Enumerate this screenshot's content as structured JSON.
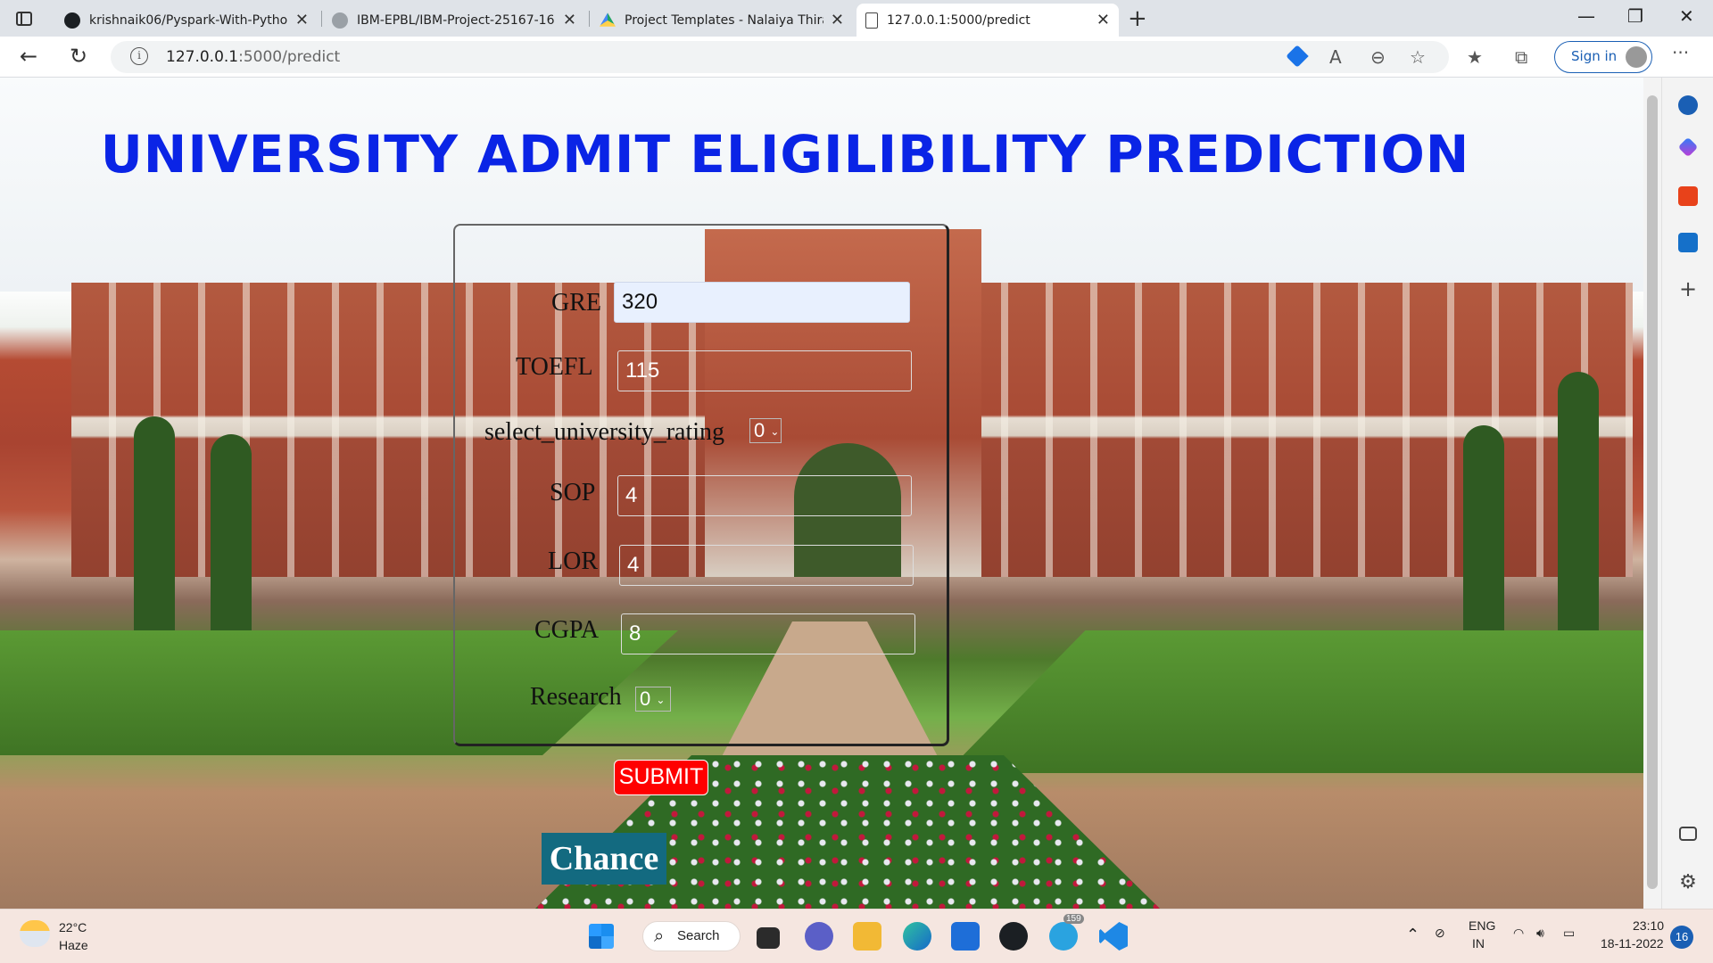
{
  "browser": {
    "tabs": [
      {
        "title": "krishnaik06/Pyspark-With-Pytho",
        "icon": "github-icon"
      },
      {
        "title": "IBM-EPBL/IBM-Project-25167-16",
        "icon": "github-icon"
      },
      {
        "title": "Project Templates - Nalaiya Thira",
        "icon": "google-drive-icon"
      },
      {
        "title": "127.0.0.1:5000/predict",
        "icon": "document-icon"
      }
    ],
    "url_host": "127.0.0.1",
    "url_path": ":5000/predict",
    "signin_label": "Sign in"
  },
  "page": {
    "title": "UNIVERSITY ADMIT ELIGILIBILITY PREDICTION",
    "form": {
      "gre_label": "GRE",
      "gre_value": "320",
      "toefl_label": "TOEFL",
      "toefl_value": "115",
      "rating_label": "select_university_rating",
      "rating_value": "0",
      "sop_label": "SOP",
      "sop_value": "4",
      "lor_label": "LOR",
      "lor_value": "4",
      "cgpa_label": "CGPA",
      "cgpa_value": "8",
      "research_label": "Research",
      "research_value": "0"
    },
    "submit_label": "SUBMIT",
    "result_text": "Chance"
  },
  "taskbar": {
    "temperature": "22°C",
    "weather": "Haze",
    "search_label": "Search",
    "telegram_badge": "159",
    "language": "ENG",
    "region": "IN",
    "time": "23:10",
    "date": "18-11-2022",
    "notification_count": "16"
  },
  "colors": {
    "title": "#0a24e6",
    "submit_bg": "#ff0000",
    "chance_bg": "#136a80",
    "accent": "#1a5fb4"
  }
}
